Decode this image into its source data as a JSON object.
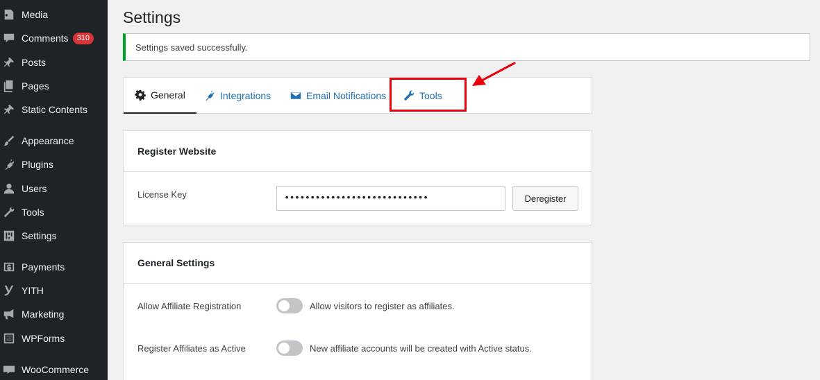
{
  "sidebar": {
    "items": [
      {
        "label": "Media",
        "icon": "media-icon"
      },
      {
        "label": "Comments",
        "icon": "comments-icon",
        "badge": "310"
      },
      {
        "label": "Posts",
        "icon": "pin-icon"
      },
      {
        "label": "Pages",
        "icon": "pages-icon"
      },
      {
        "label": "Static Contents",
        "icon": "pin-icon"
      },
      {
        "label": "Appearance",
        "icon": "brush-icon"
      },
      {
        "label": "Plugins",
        "icon": "plugin-icon"
      },
      {
        "label": "Users",
        "icon": "user-icon"
      },
      {
        "label": "Tools",
        "icon": "wrench-icon"
      },
      {
        "label": "Settings",
        "icon": "sliders-icon"
      },
      {
        "label": "Payments",
        "icon": "dollar-icon"
      },
      {
        "label": "YITH",
        "icon": "yith-icon"
      },
      {
        "label": "Marketing",
        "icon": "megaphone-icon"
      },
      {
        "label": "WPForms",
        "icon": "forms-icon"
      },
      {
        "label": "WooCommerce",
        "icon": "woo-icon"
      }
    ]
  },
  "page": {
    "title": "Settings",
    "notice": "Settings saved successfully."
  },
  "tabs": [
    {
      "label": "General",
      "icon": "gear-icon",
      "active": true
    },
    {
      "label": "Integrations",
      "icon": "plug-icon"
    },
    {
      "label": "Email Notifications",
      "icon": "envelope-icon"
    },
    {
      "label": "Tools",
      "icon": "wrench-icon"
    }
  ],
  "register": {
    "title": "Register Website",
    "license_label": "License Key",
    "license_value": "••••••••••••••••••••••••••••",
    "deregister_label": "Deregister"
  },
  "general": {
    "title": "General Settings",
    "rows": [
      {
        "label": "Allow Affiliate Registration",
        "description": "Allow visitors to register as affiliates.",
        "enabled": false
      },
      {
        "label": "Register Affiliates as Active",
        "description": "New affiliate accounts will be created with Active status.",
        "enabled": false
      }
    ]
  },
  "colors": {
    "sidebar_bg": "#1d2327",
    "badge": "#d63638",
    "notice_success": "#00a32a",
    "link": "#2271b1",
    "highlight": "#e8000b"
  }
}
